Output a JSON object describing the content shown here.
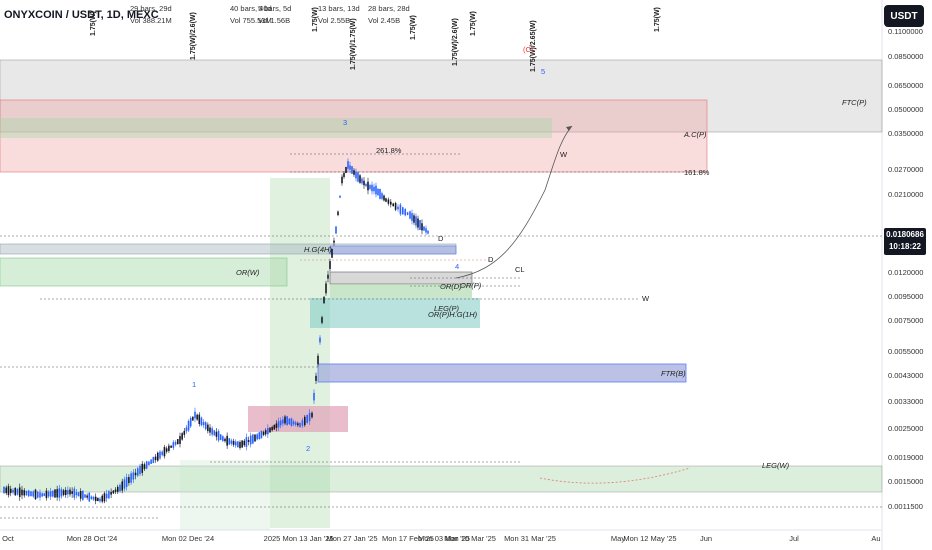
{
  "header": {
    "title": "ONYXCOIN / USDT, 1D, MEXC",
    "currency_button": "USDT"
  },
  "stats": [
    {
      "bars": "29 bars, 29d",
      "vol": "Vol 388.21M"
    },
    {
      "bars": "40 bars, 40d",
      "vol": "Vol 755.53M"
    },
    {
      "bars": "5 bars, 5d",
      "vol": "Vol 1.56B"
    },
    {
      "bars": "13 bars, 13d",
      "vol": "Vol 2.55B"
    },
    {
      "bars": "28 bars, 28d",
      "vol": "Vol 2.45B"
    }
  ],
  "vertical_labels": [
    "1.75(W)",
    "1.75(W)/2.6(W)",
    "1.75(W)",
    "1.75(W)/1.75(W)",
    "1.75(W)",
    "1.75(W)/2.6(W)",
    "1.75(W)",
    "1.75(W)/2.65(W)",
    "1.75(W)"
  ],
  "price_axis": [
    "0.1100000",
    "0.0850000",
    "0.0650000",
    "0.0500000",
    "0.0350000",
    "0.0270000",
    "0.0210000",
    "0.0120000",
    "0.0095000",
    "0.0075000",
    "0.0055000",
    "0.0043000",
    "0.0033000",
    "0.0025000",
    "0.0019000",
    "0.0015000",
    "0.0011500"
  ],
  "current_price": {
    "value": "0.0180686",
    "countdown": "10:18:22"
  },
  "time_axis": [
    "Oct",
    "Mon 28 Oct '24",
    "Mon 02 Dec '24",
    "2025",
    "Mon 13 Jan '25",
    "Mon 27 Jan '25",
    "Mon 17 Feb '25",
    "Mon 03 Mar '25",
    "Mon 10 Mar '25",
    "Mon 31 Mar '25",
    "May",
    "Mon 12 May '25",
    "Jun",
    "Jul",
    "Au"
  ],
  "zones": {
    "ftc": "FTC(P)",
    "ac": "A.C(P)",
    "hg": "H.G(4H)",
    "or_w": "OR(W)",
    "or_d": "OR(D)",
    "or_p": "OR(P)",
    "leg_p": "LEG(P)",
    "or_hg": "OR(P)H.G(1H)",
    "ftr": "FTR(B)",
    "leg_w": "LEG(W)"
  },
  "annotations": {
    "fib_261_left": "261.8%",
    "fib_161": "161.8%",
    "w_top": "W",
    "w_mid": "W",
    "d1": "D",
    "d2": "D",
    "cl": "CL",
    "wave3": "3",
    "wave4": "4",
    "wave5": "5",
    "wave1": "1",
    "wave2": "2",
    "wave_c": "(C)"
  },
  "colors": {
    "bull": "#2962ff",
    "bear": "#131722",
    "green_zone": "#4caf50",
    "red_zone": "#e57373",
    "blue_zone": "#5c7cfa",
    "gray_zone": "#9e9e9e"
  }
}
